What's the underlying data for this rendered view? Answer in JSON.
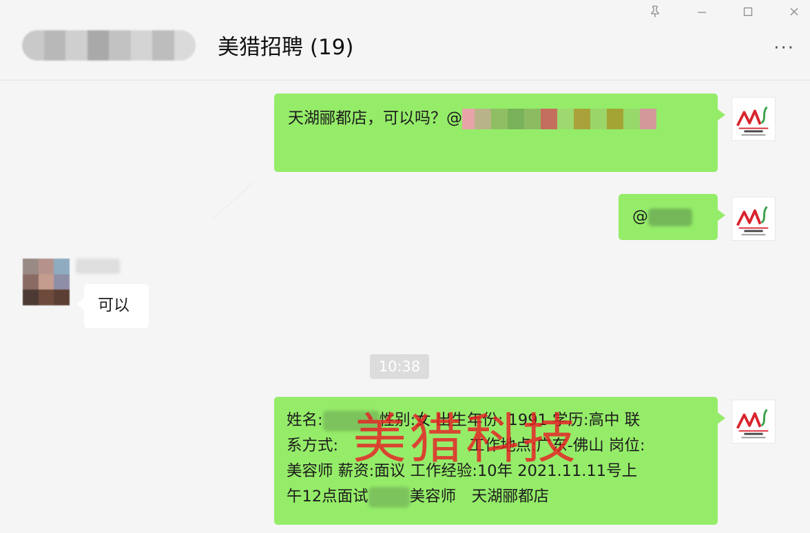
{
  "window": {
    "pin_icon": "pin-icon",
    "minimize_icon": "minimize-icon",
    "maximize_icon": "maximize-icon",
    "close_icon": "close-icon"
  },
  "header": {
    "title": "美猎招聘 (19)",
    "more_icon": "more-icon"
  },
  "messages": [
    {
      "side": "right",
      "text": "天湖郦都店，可以吗？@"
    },
    {
      "side": "right",
      "text": "@"
    },
    {
      "side": "left",
      "text": "可以"
    },
    {
      "time": "10:38"
    },
    {
      "side": "right",
      "lines": [
        "姓名:",
        "性别:女 出生年份: 1991 学历:高中 联",
        "系方式:",
        "工作地点:广东-佛山 岗位:",
        "美容师 薪资:面议 工作经验:10年 2021.11.11号上",
        "午12点面试",
        "美容师　天湖郦都店"
      ]
    }
  ],
  "watermark": "美猎科技",
  "colors": {
    "bubble_self": "#95ec69",
    "bubble_other": "#ffffff",
    "background": "#f5f5f5",
    "watermark": "#e81e24"
  }
}
